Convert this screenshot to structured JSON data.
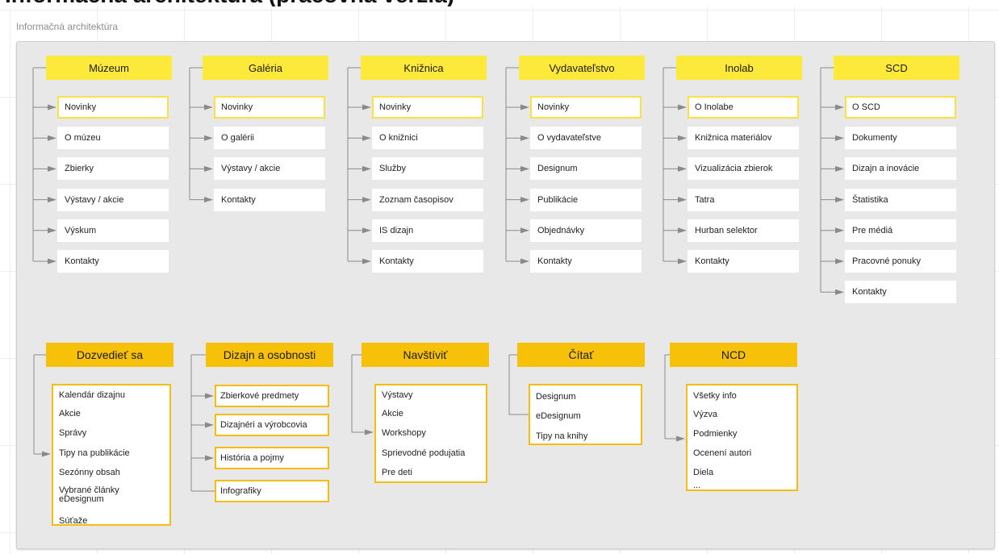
{
  "page_title": "Informačná architektúra (pracovná verzia)",
  "frame_label": "Informačná architektúra",
  "colors": {
    "header_primary": "#fde93a",
    "header_secondary": "#f7c10a",
    "panel": "#e8e8e8",
    "connector": "#8a8a8a"
  },
  "top_sections": [
    {
      "title": "Múzeum",
      "items": [
        "Novinky",
        "O múzeu",
        "Zbierky",
        "Výstavy / akcie",
        "Výskum",
        "Kontakty"
      ]
    },
    {
      "title": "Galéria",
      "items": [
        "Novinky",
        "O galérii",
        "Výstavy / akcie",
        "Kontakty"
      ]
    },
    {
      "title": "Knižnica",
      "items": [
        "Novinky",
        "O knižnici",
        "Služby",
        "Zoznam časopisov",
        "IS dizajn",
        "Kontakty"
      ]
    },
    {
      "title": "Vydavateľstvo",
      "items": [
        "Novinky",
        "O vydavateľstve",
        "Designum",
        "Publikácie",
        "Objednávky",
        "Kontakty"
      ]
    },
    {
      "title": "Inolab",
      "items": [
        "O Inolabe",
        "Knižnica materiálov",
        "Vizualizácia zbierok",
        "Tatra",
        "Hurban selektor",
        "Kontakty"
      ]
    },
    {
      "title": "SCD",
      "items": [
        "O SCD",
        "Dokumenty",
        "Dizajn a inovácie",
        "Štatistika",
        "Pre médiá",
        "Pracovné ponuky",
        "Kontakty"
      ]
    }
  ],
  "bottom_sections": [
    {
      "title": "Dozvedieť sa",
      "items": [
        "Kalendár dizajnu",
        "Akcie",
        "Správy",
        "Tipy na publikácie",
        "Sezónny obsah",
        "Vybrané články eDesignum",
        "Súťaže"
      ]
    },
    {
      "title": "Dizajn a osobnosti",
      "items": [
        "Zbierkové predmety",
        "Dizajnéri a výrobcovia",
        "História a pojmy",
        "Infografiky"
      ]
    },
    {
      "title": "Navštíviť",
      "items": [
        "Výstavy",
        "Akcie",
        "Workshopy",
        "Sprievodné podujatia",
        "Pre deti"
      ]
    },
    {
      "title": "Čítať",
      "items": [
        "Designum",
        "eDesignum",
        "Tipy na knihy"
      ]
    },
    {
      "title": "NCD",
      "items": [
        "Všetky info",
        "Výzva",
        "Podmienky",
        "Ocenení autori",
        "Diela",
        "..."
      ]
    }
  ]
}
